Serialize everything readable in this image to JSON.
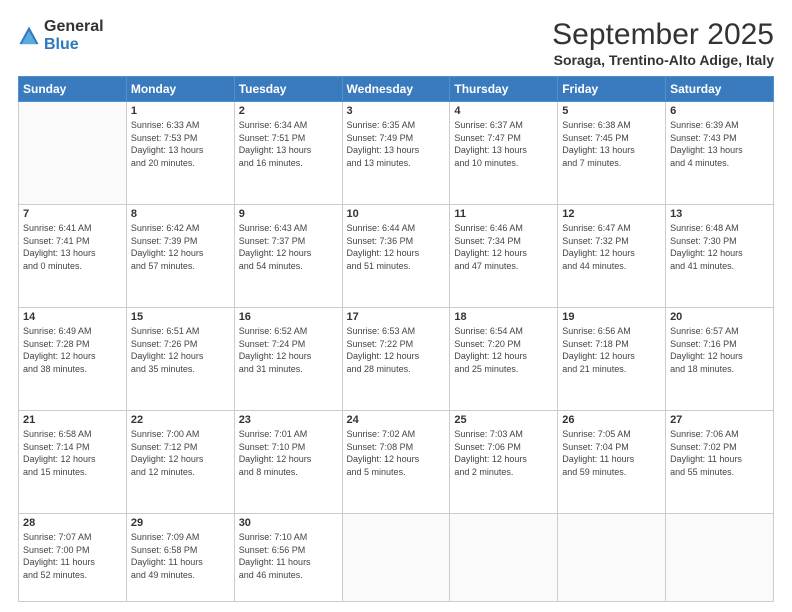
{
  "logo": {
    "general": "General",
    "blue": "Blue"
  },
  "header": {
    "month": "September 2025",
    "location": "Soraga, Trentino-Alto Adige, Italy"
  },
  "days_of_week": [
    "Sunday",
    "Monday",
    "Tuesday",
    "Wednesday",
    "Thursday",
    "Friday",
    "Saturday"
  ],
  "weeks": [
    [
      {
        "day": "",
        "info": ""
      },
      {
        "day": "1",
        "info": "Sunrise: 6:33 AM\nSunset: 7:53 PM\nDaylight: 13 hours\nand 20 minutes."
      },
      {
        "day": "2",
        "info": "Sunrise: 6:34 AM\nSunset: 7:51 PM\nDaylight: 13 hours\nand 16 minutes."
      },
      {
        "day": "3",
        "info": "Sunrise: 6:35 AM\nSunset: 7:49 PM\nDaylight: 13 hours\nand 13 minutes."
      },
      {
        "day": "4",
        "info": "Sunrise: 6:37 AM\nSunset: 7:47 PM\nDaylight: 13 hours\nand 10 minutes."
      },
      {
        "day": "5",
        "info": "Sunrise: 6:38 AM\nSunset: 7:45 PM\nDaylight: 13 hours\nand 7 minutes."
      },
      {
        "day": "6",
        "info": "Sunrise: 6:39 AM\nSunset: 7:43 PM\nDaylight: 13 hours\nand 4 minutes."
      }
    ],
    [
      {
        "day": "7",
        "info": "Sunrise: 6:41 AM\nSunset: 7:41 PM\nDaylight: 13 hours\nand 0 minutes."
      },
      {
        "day": "8",
        "info": "Sunrise: 6:42 AM\nSunset: 7:39 PM\nDaylight: 12 hours\nand 57 minutes."
      },
      {
        "day": "9",
        "info": "Sunrise: 6:43 AM\nSunset: 7:37 PM\nDaylight: 12 hours\nand 54 minutes."
      },
      {
        "day": "10",
        "info": "Sunrise: 6:44 AM\nSunset: 7:36 PM\nDaylight: 12 hours\nand 51 minutes."
      },
      {
        "day": "11",
        "info": "Sunrise: 6:46 AM\nSunset: 7:34 PM\nDaylight: 12 hours\nand 47 minutes."
      },
      {
        "day": "12",
        "info": "Sunrise: 6:47 AM\nSunset: 7:32 PM\nDaylight: 12 hours\nand 44 minutes."
      },
      {
        "day": "13",
        "info": "Sunrise: 6:48 AM\nSunset: 7:30 PM\nDaylight: 12 hours\nand 41 minutes."
      }
    ],
    [
      {
        "day": "14",
        "info": "Sunrise: 6:49 AM\nSunset: 7:28 PM\nDaylight: 12 hours\nand 38 minutes."
      },
      {
        "day": "15",
        "info": "Sunrise: 6:51 AM\nSunset: 7:26 PM\nDaylight: 12 hours\nand 35 minutes."
      },
      {
        "day": "16",
        "info": "Sunrise: 6:52 AM\nSunset: 7:24 PM\nDaylight: 12 hours\nand 31 minutes."
      },
      {
        "day": "17",
        "info": "Sunrise: 6:53 AM\nSunset: 7:22 PM\nDaylight: 12 hours\nand 28 minutes."
      },
      {
        "day": "18",
        "info": "Sunrise: 6:54 AM\nSunset: 7:20 PM\nDaylight: 12 hours\nand 25 minutes."
      },
      {
        "day": "19",
        "info": "Sunrise: 6:56 AM\nSunset: 7:18 PM\nDaylight: 12 hours\nand 21 minutes."
      },
      {
        "day": "20",
        "info": "Sunrise: 6:57 AM\nSunset: 7:16 PM\nDaylight: 12 hours\nand 18 minutes."
      }
    ],
    [
      {
        "day": "21",
        "info": "Sunrise: 6:58 AM\nSunset: 7:14 PM\nDaylight: 12 hours\nand 15 minutes."
      },
      {
        "day": "22",
        "info": "Sunrise: 7:00 AM\nSunset: 7:12 PM\nDaylight: 12 hours\nand 12 minutes."
      },
      {
        "day": "23",
        "info": "Sunrise: 7:01 AM\nSunset: 7:10 PM\nDaylight: 12 hours\nand 8 minutes."
      },
      {
        "day": "24",
        "info": "Sunrise: 7:02 AM\nSunset: 7:08 PM\nDaylight: 12 hours\nand 5 minutes."
      },
      {
        "day": "25",
        "info": "Sunrise: 7:03 AM\nSunset: 7:06 PM\nDaylight: 12 hours\nand 2 minutes."
      },
      {
        "day": "26",
        "info": "Sunrise: 7:05 AM\nSunset: 7:04 PM\nDaylight: 11 hours\nand 59 minutes."
      },
      {
        "day": "27",
        "info": "Sunrise: 7:06 AM\nSunset: 7:02 PM\nDaylight: 11 hours\nand 55 minutes."
      }
    ],
    [
      {
        "day": "28",
        "info": "Sunrise: 7:07 AM\nSunset: 7:00 PM\nDaylight: 11 hours\nand 52 minutes."
      },
      {
        "day": "29",
        "info": "Sunrise: 7:09 AM\nSunset: 6:58 PM\nDaylight: 11 hours\nand 49 minutes."
      },
      {
        "day": "30",
        "info": "Sunrise: 7:10 AM\nSunset: 6:56 PM\nDaylight: 11 hours\nand 46 minutes."
      },
      {
        "day": "",
        "info": ""
      },
      {
        "day": "",
        "info": ""
      },
      {
        "day": "",
        "info": ""
      },
      {
        "day": "",
        "info": ""
      }
    ]
  ]
}
